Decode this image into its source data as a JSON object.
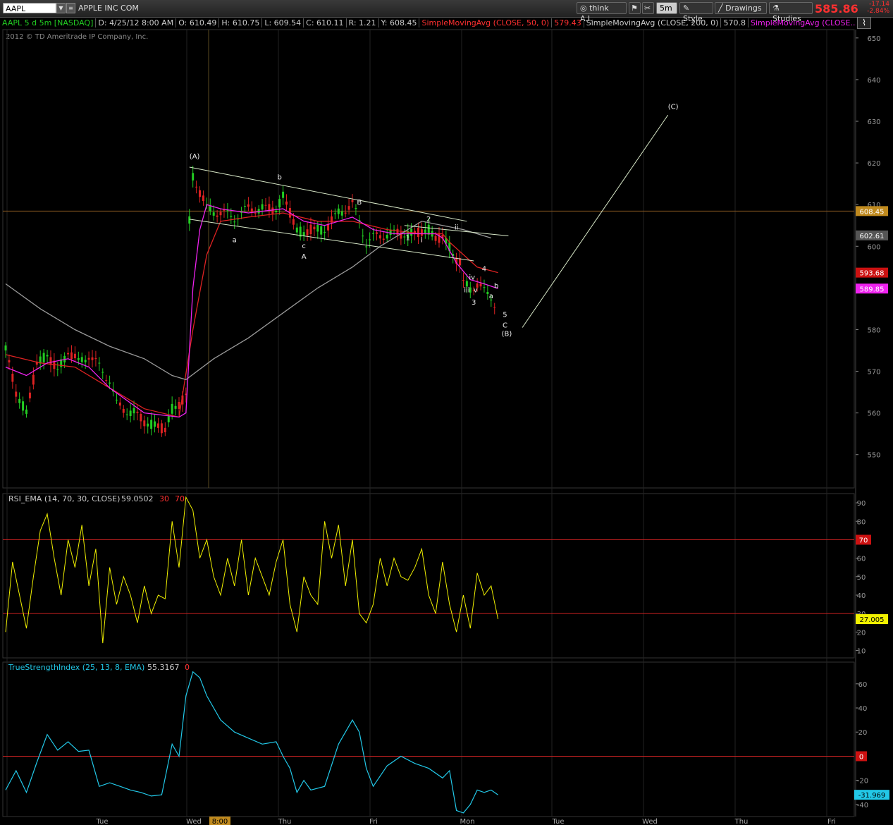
{
  "toolbar": {
    "symbol": "AAPL",
    "company": "APPLE INC COM",
    "think_label": "think A.I.",
    "timeframe": "5m",
    "style_label": "Style",
    "drawings_label": "Drawings",
    "studies_label": "Studies",
    "last_price": "585.86",
    "change": "-17.14",
    "change_pct": "-2.84%"
  },
  "header": {
    "title": "AAPL 5 d 5m [NASDAQ]",
    "date": "D: 4/25/12 8:00 AM",
    "open": "O: 610.49",
    "high": "H: 610.75",
    "low": "L: 609.54",
    "close": "C: 610.11",
    "range": "R: 1.21",
    "last": "Y: 608.45",
    "sma50_label": "SimpleMovingAvg (CLOSE, 50, 0)",
    "sma50_value": "579.43",
    "sma200_label": "SimpleMovingAvg (CLOSE, 200, 0)",
    "sma200_value": "570.8",
    "sma_other_label": "SimpleMovingAvg (CLOSE..."
  },
  "copyright": "2012 © TD Ameritrade IP Company, Inc.",
  "colors": {
    "sma50": "#dd2222",
    "sma200": "#999999",
    "sma_other": "#ee22ee",
    "rsi": "#f0f000",
    "tsi": "#22c8e8",
    "ref_line": "#cc2222",
    "candle_up": "#22cc22",
    "candle_down": "#dd2222"
  },
  "chart_data": [
    {
      "type": "line",
      "panel": "price",
      "y_ticks": [
        "650",
        "640",
        "630",
        "620",
        "610",
        "600",
        "590",
        "580",
        "570",
        "560",
        "550"
      ],
      "ylim": [
        542,
        652
      ],
      "x_ticks": [
        "Tue",
        "Wed",
        "Thu",
        "Fri",
        "Mon",
        "Tue",
        "Wed",
        "Thu",
        "Fri"
      ],
      "time_marker": "8:00",
      "series": [
        {
          "name": "AAPL",
          "kind": "candles",
          "points": [
            [
              0,
              575
            ],
            [
              3,
              565
            ],
            [
              6,
              560
            ],
            [
              9,
              572
            ],
            [
              12,
              574
            ],
            [
              15,
              570
            ],
            [
              18,
              575
            ],
            [
              21,
              572
            ],
            [
              24,
              574
            ],
            [
              27,
              571
            ],
            [
              30,
              568
            ],
            [
              32,
              562
            ],
            [
              34,
              561
            ],
            [
              37,
              560
            ],
            [
              40,
              558
            ],
            [
              43,
              557
            ],
            [
              46,
              556
            ],
            [
              48,
              561
            ],
            [
              50,
              562
            ],
            [
              52,
              564
            ],
            [
              53,
              606
            ],
            [
              54,
              617
            ],
            [
              56,
              613
            ],
            [
              58,
              609
            ],
            [
              62,
              608
            ],
            [
              66,
              607
            ],
            [
              70,
              609
            ],
            [
              74,
              609
            ],
            [
              78,
              609
            ],
            [
              80,
              612
            ],
            [
              82,
              608
            ],
            [
              84,
              604
            ],
            [
              86,
              603
            ],
            [
              88,
              604
            ],
            [
              92,
              604
            ],
            [
              96,
              608
            ],
            [
              100,
              610
            ],
            [
              102,
              606
            ],
            [
              104,
              601
            ],
            [
              106,
              602
            ],
            [
              110,
              603
            ],
            [
              114,
              603
            ],
            [
              118,
              603
            ],
            [
              122,
              604
            ],
            [
              124,
              602
            ],
            [
              126,
              602
            ],
            [
              128,
              600
            ],
            [
              130,
              597
            ],
            [
              131,
              596
            ],
            [
              132,
              591
            ],
            [
              134,
              590
            ],
            [
              136,
              591
            ],
            [
              138,
              589
            ],
            [
              140,
              588
            ],
            [
              142,
              585
            ]
          ]
        },
        {
          "name": "SimpleMovingAvg (CLOSE, 50, 0)",
          "kind": "line",
          "points": [
            [
              0,
              574
            ],
            [
              10,
              572
            ],
            [
              20,
              571
            ],
            [
              30,
              566
            ],
            [
              40,
              561
            ],
            [
              50,
              559
            ],
            [
              54,
              580
            ],
            [
              58,
              598
            ],
            [
              62,
              606
            ],
            [
              70,
              607
            ],
            [
              80,
              608
            ],
            [
              90,
              606
            ],
            [
              100,
              606
            ],
            [
              110,
              604
            ],
            [
              120,
              603
            ],
            [
              126,
              603
            ],
            [
              128,
              601
            ],
            [
              132,
              598
            ],
            [
              136,
              595
            ],
            [
              142,
              593.68
            ]
          ]
        },
        {
          "name": "SimpleMovingAvg (CLOSE, 200, 0)",
          "kind": "line",
          "points": [
            [
              0,
              591
            ],
            [
              10,
              585
            ],
            [
              20,
              580
            ],
            [
              30,
              576
            ],
            [
              40,
              573
            ],
            [
              48,
              569
            ],
            [
              52,
              568
            ],
            [
              60,
              573
            ],
            [
              70,
              578
            ],
            [
              80,
              584
            ],
            [
              90,
              590
            ],
            [
              100,
              595
            ],
            [
              108,
              600
            ],
            [
              116,
              604
            ],
            [
              120,
              606
            ],
            [
              126,
              605
            ],
            [
              132,
              604
            ],
            [
              140,
              602
            ]
          ]
        },
        {
          "name": "SimpleMovingAvg (CLOSE...",
          "kind": "line",
          "points": [
            [
              0,
              571
            ],
            [
              6,
              569
            ],
            [
              12,
              572
            ],
            [
              18,
              573
            ],
            [
              24,
              571
            ],
            [
              30,
              566
            ],
            [
              40,
              560
            ],
            [
              50,
              559
            ],
            [
              52,
              560
            ],
            [
              54,
              590
            ],
            [
              56,
              604
            ],
            [
              58,
              610
            ],
            [
              62,
              609
            ],
            [
              70,
              608
            ],
            [
              80,
              609
            ],
            [
              86,
              606
            ],
            [
              92,
              605
            ],
            [
              100,
              607
            ],
            [
              106,
              604
            ],
            [
              112,
              603
            ],
            [
              118,
              603
            ],
            [
              124,
              603
            ],
            [
              126,
              602
            ],
            [
              130,
              596
            ],
            [
              134,
              592
            ],
            [
              138,
              591
            ],
            [
              142,
              589.85
            ]
          ]
        }
      ],
      "price_tags": [
        {
          "value": "608.45",
          "bg": "#c08a1e",
          "fg": "#ffffff"
        },
        {
          "value": "602.61",
          "bg": "#555555",
          "fg": "#ffffff"
        },
        {
          "value": "593.68",
          "bg": "#cc1111",
          "fg": "#ffffff"
        },
        {
          "value": "589.85",
          "bg": "#ee22ee",
          "fg": "#ffffff"
        }
      ],
      "annotations": [
        "(A)",
        "b",
        "a",
        "c",
        "A",
        "B",
        "1",
        "2",
        "i",
        "ii",
        "iv",
        "iii",
        "v",
        "3",
        "4",
        "b",
        "a",
        "5",
        "C",
        "(B)",
        "(C)"
      ]
    },
    {
      "type": "line",
      "panel": "rsi",
      "title": "RSI_EMA (14, 70, 30, CLOSE)",
      "value": "59.0502",
      "levels": [
        "30",
        "70"
      ],
      "y_ticks": [
        "90",
        "80",
        "70",
        "60",
        "50",
        "40",
        "30",
        "20",
        "10"
      ],
      "ylim": [
        6,
        95
      ],
      "last_tag": "27.005",
      "series": [
        {
          "name": "RSI_EMA",
          "points": [
            [
              0,
              20
            ],
            [
              2,
              58
            ],
            [
              4,
              40
            ],
            [
              6,
              22
            ],
            [
              8,
              50
            ],
            [
              10,
              75
            ],
            [
              12,
              84
            ],
            [
              14,
              60
            ],
            [
              16,
              40
            ],
            [
              18,
              70
            ],
            [
              20,
              55
            ],
            [
              22,
              78
            ],
            [
              24,
              45
            ],
            [
              26,
              65
            ],
            [
              28,
              14
            ],
            [
              30,
              55
            ],
            [
              32,
              35
            ],
            [
              34,
              50
            ],
            [
              36,
              40
            ],
            [
              38,
              25
            ],
            [
              40,
              45
            ],
            [
              42,
              30
            ],
            [
              44,
              40
            ],
            [
              46,
              38
            ],
            [
              48,
              80
            ],
            [
              50,
              55
            ],
            [
              52,
              93
            ],
            [
              54,
              86
            ],
            [
              56,
              60
            ],
            [
              58,
              70
            ],
            [
              60,
              50
            ],
            [
              62,
              40
            ],
            [
              64,
              60
            ],
            [
              66,
              45
            ],
            [
              68,
              70
            ],
            [
              70,
              40
            ],
            [
              72,
              60
            ],
            [
              74,
              50
            ],
            [
              76,
              40
            ],
            [
              78,
              58
            ],
            [
              80,
              70
            ],
            [
              82,
              35
            ],
            [
              84,
              20
            ],
            [
              86,
              50
            ],
            [
              88,
              40
            ],
            [
              90,
              35
            ],
            [
              92,
              80
            ],
            [
              94,
              60
            ],
            [
              96,
              78
            ],
            [
              98,
              45
            ],
            [
              100,
              70
            ],
            [
              102,
              30
            ],
            [
              104,
              25
            ],
            [
              106,
              35
            ],
            [
              108,
              60
            ],
            [
              110,
              45
            ],
            [
              112,
              60
            ],
            [
              114,
              50
            ],
            [
              116,
              48
            ],
            [
              118,
              55
            ],
            [
              120,
              65
            ],
            [
              122,
              40
            ],
            [
              124,
              30
            ],
            [
              126,
              58
            ],
            [
              128,
              35
            ],
            [
              130,
              20
            ],
            [
              132,
              40
            ],
            [
              134,
              22
            ],
            [
              136,
              52
            ],
            [
              138,
              40
            ],
            [
              140,
              45
            ],
            [
              142,
              27
            ]
          ]
        }
      ]
    },
    {
      "type": "line",
      "panel": "tsi",
      "title": "TrueStrengthIndex (25, 13, 8, EMA)",
      "value": "55.3167",
      "levels": [
        "0"
      ],
      "y_ticks": [
        "60",
        "40",
        "20",
        "0",
        "-20",
        "-40"
      ],
      "ylim": [
        -50,
        78
      ],
      "last_tag": "-31.969",
      "series": [
        {
          "name": "TrueStrengthIndex",
          "points": [
            [
              0,
              -28
            ],
            [
              3,
              -12
            ],
            [
              6,
              -30
            ],
            [
              9,
              -5
            ],
            [
              12,
              18
            ],
            [
              15,
              5
            ],
            [
              18,
              12
            ],
            [
              21,
              4
            ],
            [
              24,
              5
            ],
            [
              27,
              -25
            ],
            [
              30,
              -22
            ],
            [
              33,
              -25
            ],
            [
              36,
              -28
            ],
            [
              39,
              -30
            ],
            [
              42,
              -33
            ],
            [
              45,
              -32
            ],
            [
              48,
              10
            ],
            [
              50,
              0
            ],
            [
              52,
              50
            ],
            [
              54,
              70
            ],
            [
              56,
              65
            ],
            [
              58,
              50
            ],
            [
              62,
              30
            ],
            [
              66,
              20
            ],
            [
              70,
              15
            ],
            [
              74,
              10
            ],
            [
              78,
              12
            ],
            [
              80,
              0
            ],
            [
              82,
              -10
            ],
            [
              84,
              -30
            ],
            [
              86,
              -20
            ],
            [
              88,
              -28
            ],
            [
              92,
              -25
            ],
            [
              96,
              10
            ],
            [
              100,
              30
            ],
            [
              102,
              20
            ],
            [
              104,
              -10
            ],
            [
              106,
              -25
            ],
            [
              110,
              -8
            ],
            [
              114,
              0
            ],
            [
              118,
              -6
            ],
            [
              122,
              -10
            ],
            [
              126,
              -18
            ],
            [
              128,
              -12
            ],
            [
              130,
              -45
            ],
            [
              132,
              -47
            ],
            [
              134,
              -40
            ],
            [
              136,
              -28
            ],
            [
              138,
              -30
            ],
            [
              140,
              -28
            ],
            [
              142,
              -32
            ]
          ]
        }
      ]
    }
  ]
}
